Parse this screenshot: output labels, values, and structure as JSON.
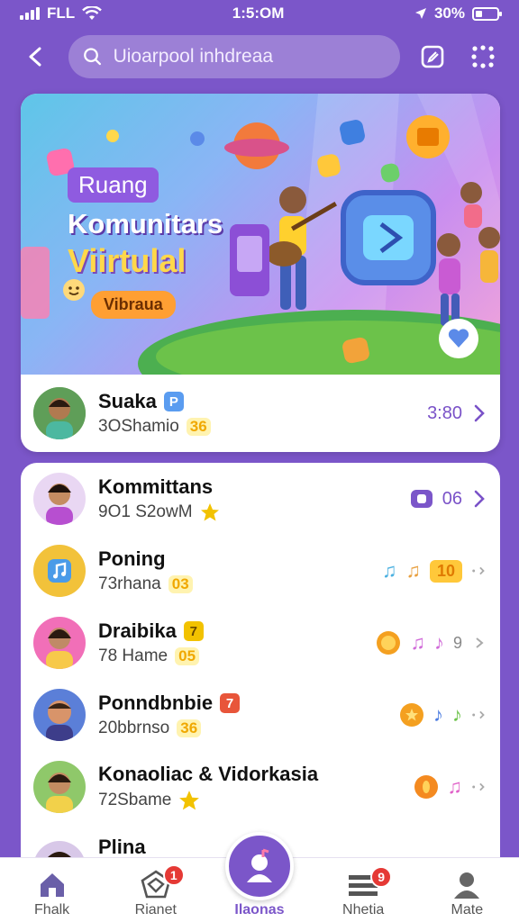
{
  "status_bar": {
    "carrier": "FLL",
    "time": "1:5:OM",
    "battery": "30%",
    "battery_level": 0.3
  },
  "header": {
    "search_placeholder": "Uioarpool inhdreaa"
  },
  "banner": {
    "tag": "Ruang",
    "title_line1": "Komunitars",
    "title_line2": "Viirtulal",
    "pill": "Vibraua"
  },
  "featured": {
    "title": "Suaka",
    "title_badge": "P",
    "subtitle": "3OShamio",
    "subtitle_badge": "36",
    "meta": "3:80"
  },
  "list": [
    {
      "title": "Kommittans",
      "subtitle": "9O1 S2owM",
      "meta": "06",
      "badge_color": "#f2c200"
    },
    {
      "title": "Poning",
      "subtitle": "73rhana",
      "subtitle_badge": "03",
      "avatar_color": "#f2c23a"
    },
    {
      "title": "Draibika",
      "title_badge": "7",
      "subtitle": "78 Hame",
      "subtitle_badge": "05"
    },
    {
      "title": "Ponndbnbie",
      "title_badge": "7",
      "subtitle": "20bbrnso",
      "subtitle_badge": "36"
    },
    {
      "title": "Konaoliac & Vidorkasia",
      "subtitle": "72Sbame"
    },
    {
      "title": "Plina"
    }
  ],
  "row_extras": {
    "row2_tag": "10",
    "row3_suffix": "9"
  },
  "bottom_nav": [
    {
      "label": "Fhalk",
      "icon": "home-icon"
    },
    {
      "label": "Rianet",
      "icon": "sticker-icon",
      "badge": "1"
    },
    {
      "label": "Ilaonas",
      "icon": "music-person-icon",
      "active": true
    },
    {
      "label": "Nhetia",
      "icon": "list-icon",
      "badge": "9"
    },
    {
      "label": "Mate",
      "icon": "profile-icon"
    }
  ],
  "colors": {
    "brand": "#7b56c9",
    "accent_yellow": "#f2c200",
    "badge_red": "#e53935"
  }
}
